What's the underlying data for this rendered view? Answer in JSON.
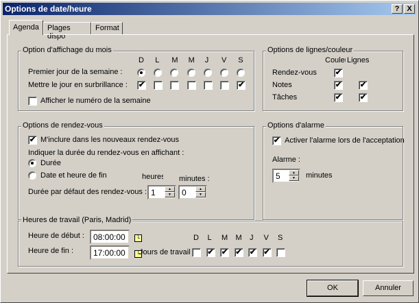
{
  "window": {
    "title": "Options de date/heure",
    "help": "?",
    "close": "X"
  },
  "tabs": [
    "Agenda",
    "Plages dispo",
    "Format"
  ],
  "month": {
    "legend": "Option d'affichage du mois",
    "days": [
      "D",
      "L",
      "M",
      "M",
      "J",
      "V",
      "S"
    ],
    "first_day_label": "Premier jour de la semaine :",
    "first_day_selected": 0,
    "highlight_label": "Mettre le jour en surbrillance :",
    "highlight": [
      true,
      false,
      false,
      false,
      false,
      false,
      true
    ],
    "week_number_label": "Afficher le numéro de la semaine",
    "week_number": false
  },
  "lines": {
    "legend": "Options de lignes/couleur",
    "col_color": "Couleur",
    "col_lines": "Lignes",
    "rows": [
      {
        "label": "Rendez-vous",
        "color": true,
        "lines": null
      },
      {
        "label": "Notes",
        "color": true,
        "lines": true
      },
      {
        "label": "Tâches",
        "color": true,
        "lines": true
      }
    ]
  },
  "appt": {
    "legend": "Options de rendez-vous",
    "include_label": "M'inclure dans les nouveaux rendez-vous",
    "include": true,
    "indicate_label": "Indiquer la durée du rendez-vous en affichant :",
    "opt_duration": "Durée",
    "opt_end": "Date et heure de fin",
    "selected": "duration",
    "hours_label": "heures",
    "minutes_label": "minutes :",
    "default_label": "Durée par défaut des rendez-vous :",
    "hours": "1",
    "minutes": "0"
  },
  "alarm": {
    "legend": "Options d'alarme",
    "activate_label": "Activer l'alarme lors de l'acceptation",
    "activate": true,
    "alarm_label": "Alarme :",
    "value": "5",
    "unit": "minutes"
  },
  "work": {
    "legend": "Heures de travail (Paris, Madrid)",
    "start_label": "Heure de début :",
    "start": "08:00:00",
    "end_label": "Heure de fin :",
    "end": "17:00:00",
    "days_label": "Jours de travail :",
    "days": [
      "D",
      "L",
      "M",
      "M",
      "J",
      "V",
      "S"
    ],
    "workdays": [
      false,
      true,
      true,
      true,
      true,
      true,
      false
    ]
  },
  "buttons": {
    "ok": "OK",
    "cancel": "Annuler"
  }
}
